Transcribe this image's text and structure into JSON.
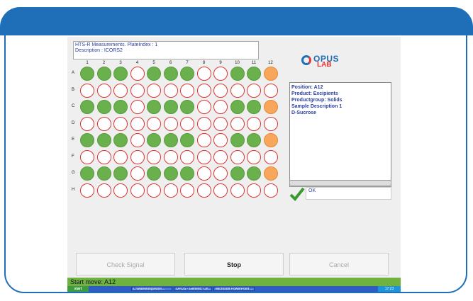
{
  "info": {
    "title": "HTS-R Measurements. PlateIndex : 1",
    "description": "Description : ICORS2"
  },
  "logo": {
    "brand": "OPUS",
    "sub": "LAB"
  },
  "plate": {
    "columns": [
      "1",
      "2",
      "3",
      "4",
      "5",
      "6",
      "7",
      "8",
      "9",
      "10",
      "11",
      "12"
    ],
    "rows": [
      "A",
      "B",
      "C",
      "D",
      "E",
      "F",
      "G",
      "H"
    ],
    "wells": [
      [
        "g",
        "g",
        "g",
        "w",
        "g",
        "g",
        "g",
        "w",
        "w",
        "g",
        "g",
        "o"
      ],
      [
        "w",
        "w",
        "w",
        "w",
        "w",
        "w",
        "w",
        "w",
        "w",
        "w",
        "w",
        "w"
      ],
      [
        "g",
        "g",
        "g",
        "w",
        "g",
        "g",
        "g",
        "w",
        "w",
        "g",
        "g",
        "o"
      ],
      [
        "w",
        "w",
        "w",
        "w",
        "w",
        "w",
        "w",
        "w",
        "w",
        "w",
        "w",
        "w"
      ],
      [
        "g",
        "g",
        "g",
        "w",
        "g",
        "g",
        "g",
        "w",
        "w",
        "g",
        "g",
        "o"
      ],
      [
        "w",
        "w",
        "w",
        "w",
        "w",
        "w",
        "w",
        "w",
        "w",
        "w",
        "w",
        "w"
      ],
      [
        "g",
        "g",
        "g",
        "w",
        "g",
        "g",
        "g",
        "w",
        "w",
        "g",
        "g",
        "o"
      ],
      [
        "w",
        "w",
        "w",
        "w",
        "w",
        "w",
        "w",
        "w",
        "w",
        "w",
        "w",
        "w"
      ]
    ]
  },
  "details": {
    "position": "Position: A12",
    "product": "Product: Excipients",
    "productgroup": "Productgroup: Solids",
    "sample": "Sample Description 1",
    "substance": "D-Sucrose"
  },
  "status": {
    "text": "OK"
  },
  "buttons": {
    "check_signal": "Check Signal",
    "stop": "Stop",
    "cancel": "Cancel"
  },
  "statusbar": {
    "text": "Start move: A12"
  },
  "taskbar": {
    "start": "start",
    "items": [
      "L:\\Marketing\\Wolf\\...",
      "OPUS - Generic: On...",
      "Microsoft PowerPoint ..."
    ],
    "clock": "17:23"
  },
  "colors": {
    "banner": "#1f6eb8",
    "filled": "#6ab04c",
    "selected": "#f7a65c",
    "statusbar": "#6fb23f"
  }
}
